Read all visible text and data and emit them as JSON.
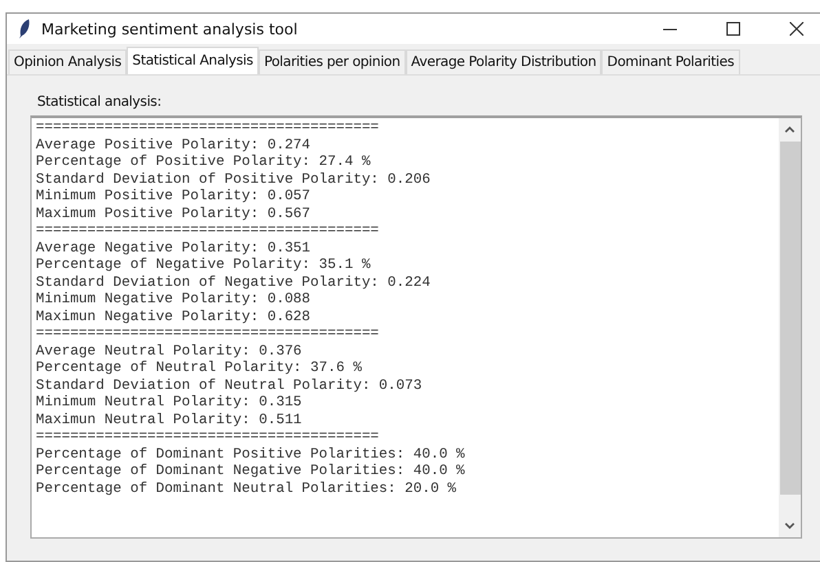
{
  "window": {
    "title": "Marketing sentiment analysis tool"
  },
  "tabs": [
    {
      "label": "Opinion Analysis",
      "selected": false
    },
    {
      "label": "Statistical Analysis",
      "selected": true
    },
    {
      "label": "Polarities per opinion",
      "selected": false
    },
    {
      "label": "Average Polarity Distribution",
      "selected": false
    },
    {
      "label": "Dominant Polarities",
      "selected": false
    }
  ],
  "section_label": "Statistical analysis:",
  "output_lines": [
    "========================================",
    "Average Positive Polarity: 0.274",
    "Percentage of Positive Polarity: 27.4 %",
    "Standard Deviation of Positive Polarity: 0.206",
    "Minimum Positive Polarity: 0.057",
    "Maximum Positive Polarity: 0.567",
    "========================================",
    "Average Negative Polarity: 0.351",
    "Percentage of Negative Polarity: 35.1 %",
    "Standard Deviation of Negative Polarity: 0.224",
    "Minimum Negative Polarity: 0.088",
    "Maximun Negative Polarity: 0.628",
    "========================================",
    "Average Neutral Polarity: 0.376",
    "Percentage of Neutral Polarity: 37.6 %",
    "Standard Deviation of Neutral Polarity: 0.073",
    "Minimum Neutral Polarity: 0.315",
    "Maximun Neutral Polarity: 0.511",
    "========================================",
    "Percentage of Dominant Positive Polarities: 40.0 %",
    "Percentage of Dominant Negative Polarities: 40.0 %",
    "Percentage of Dominant Neutral Polarities: 20.0 %"
  ]
}
